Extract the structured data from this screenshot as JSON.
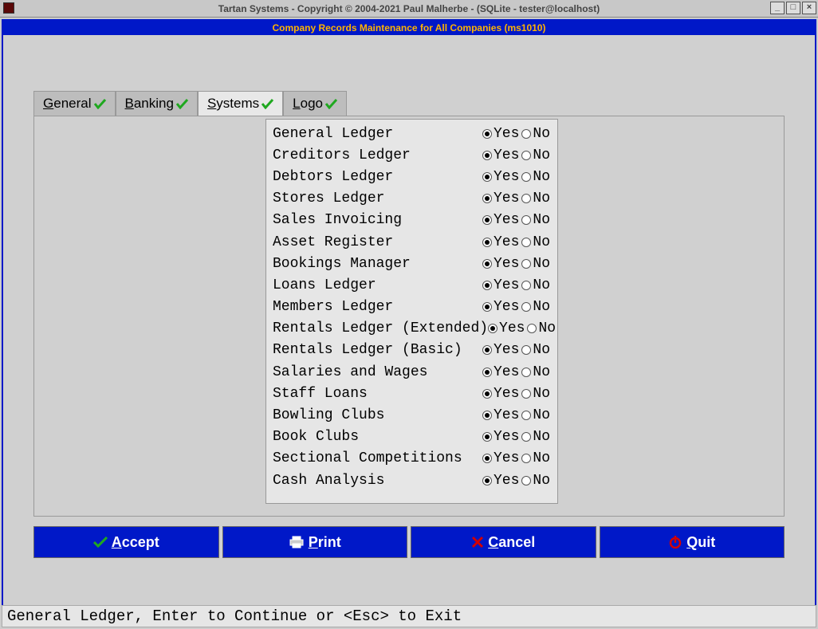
{
  "titlebar": {
    "text": "Tartan Systems - Copyright © 2004-2021 Paul Malherbe - (SQLite - tester@localhost)"
  },
  "banner": {
    "text": "Company Records Maintenance for All Companies (ms1010)"
  },
  "tabs": [
    {
      "label": "General",
      "accel": "G"
    },
    {
      "label": "Banking",
      "accel": "B"
    },
    {
      "label": "Systems",
      "accel": "S"
    },
    {
      "label": "Logo",
      "accel": "L"
    }
  ],
  "active_tab": 2,
  "options": {
    "yes": "Yes",
    "no": "No"
  },
  "systems": [
    {
      "label": "General Ledger",
      "value": "yes"
    },
    {
      "label": "Creditors Ledger",
      "value": "yes"
    },
    {
      "label": "Debtors Ledger",
      "value": "yes"
    },
    {
      "label": "Stores Ledger",
      "value": "yes"
    },
    {
      "label": "Sales Invoicing",
      "value": "yes"
    },
    {
      "label": "Asset Register",
      "value": "yes"
    },
    {
      "label": "Bookings Manager",
      "value": "yes"
    },
    {
      "label": "Loans Ledger",
      "value": "yes"
    },
    {
      "label": "Members Ledger",
      "value": "yes"
    },
    {
      "label": "Rentals Ledger (Extended)",
      "value": "yes"
    },
    {
      "label": "Rentals Ledger (Basic)",
      "value": "yes"
    },
    {
      "label": "Salaries and Wages",
      "value": "yes"
    },
    {
      "label": "Staff Loans",
      "value": "yes"
    },
    {
      "label": "Bowling Clubs",
      "value": "yes"
    },
    {
      "label": "Book Clubs",
      "value": "yes"
    },
    {
      "label": "Sectional Competitions",
      "value": "yes"
    },
    {
      "label": "Cash Analysis",
      "value": "yes"
    }
  ],
  "buttons": {
    "accept": "Accept",
    "print": "Print",
    "cancel": "Cancel",
    "quit": "Quit"
  },
  "statusbar": {
    "text": "General Ledger, Enter to Continue or <Esc> to Exit"
  }
}
